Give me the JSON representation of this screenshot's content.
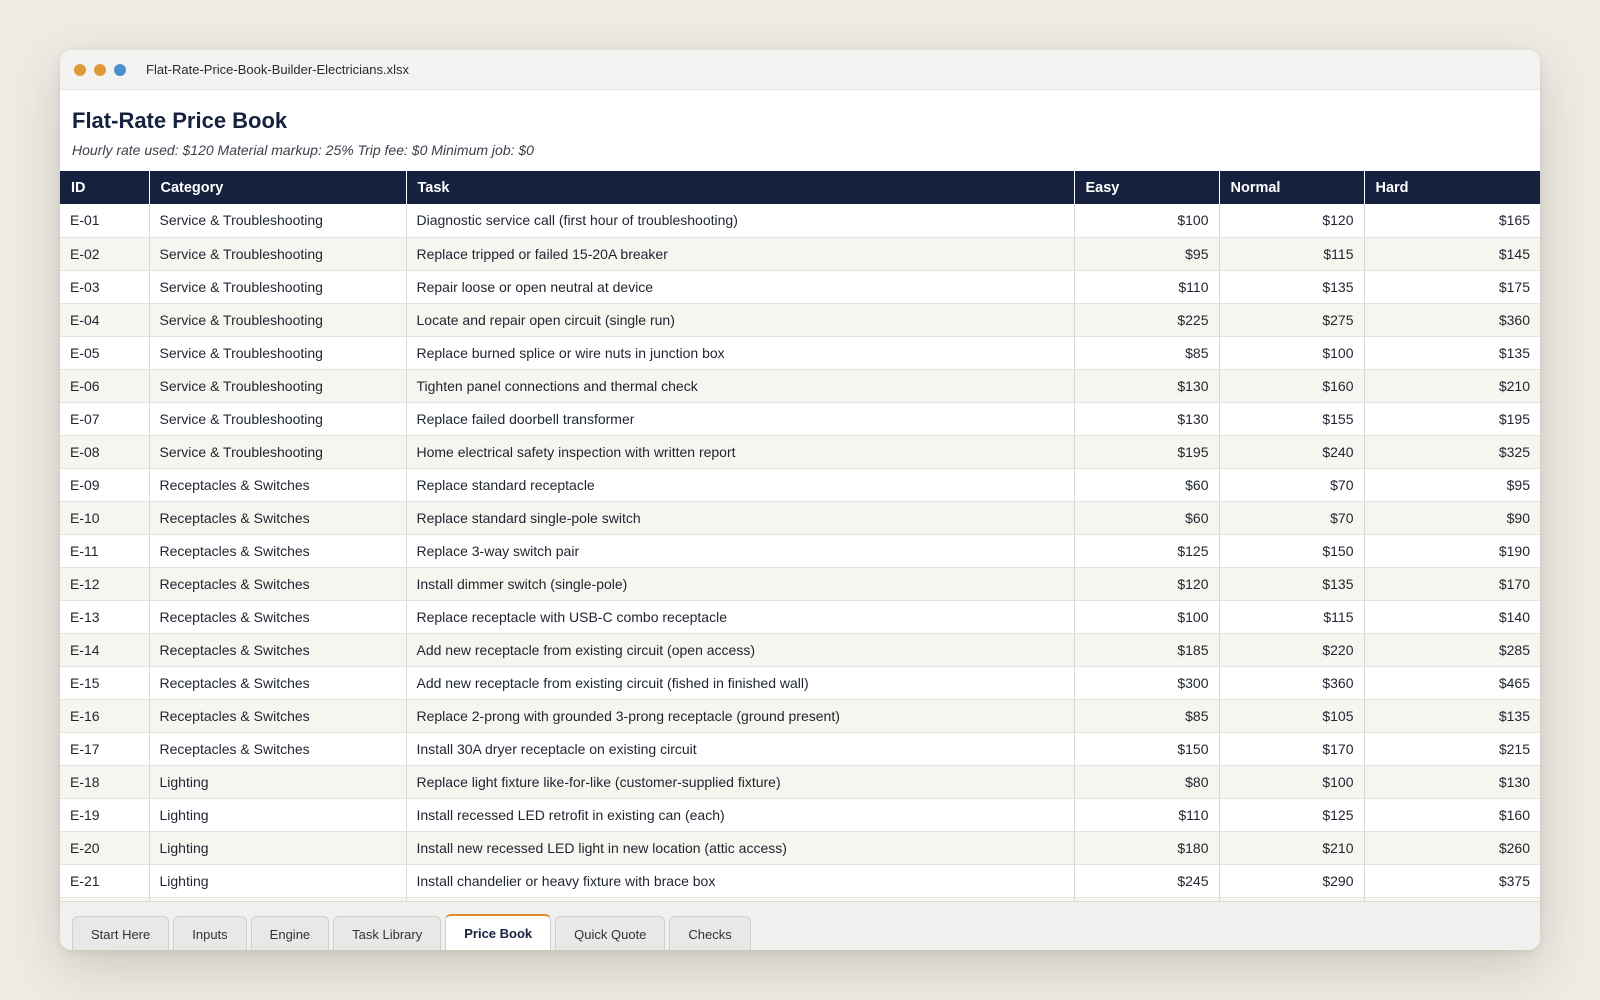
{
  "window": {
    "filename": "Flat-Rate-Price-Book-Builder-Electricians.xlsx"
  },
  "sheet": {
    "title": "Flat-Rate Price Book",
    "subtitle": "Hourly rate used: $120  Material markup: 25%  Trip fee: $0  Minimum job: $0"
  },
  "table": {
    "headers": [
      "ID",
      "Category",
      "Task",
      "Easy",
      "Normal",
      "Hard"
    ],
    "rows": [
      [
        "E-01",
        "Service & Troubleshooting",
        "Diagnostic service call (first hour of troubleshooting)",
        "$100",
        "$120",
        "$165"
      ],
      [
        "E-02",
        "Service & Troubleshooting",
        "Replace tripped or failed 15-20A breaker",
        "$95",
        "$115",
        "$145"
      ],
      [
        "E-03",
        "Service & Troubleshooting",
        "Repair loose or open neutral at device",
        "$110",
        "$135",
        "$175"
      ],
      [
        "E-04",
        "Service & Troubleshooting",
        "Locate and repair open circuit (single run)",
        "$225",
        "$275",
        "$360"
      ],
      [
        "E-05",
        "Service & Troubleshooting",
        "Replace burned splice or wire nuts in junction box",
        "$85",
        "$100",
        "$135"
      ],
      [
        "E-06",
        "Service & Troubleshooting",
        "Tighten panel connections and thermal check",
        "$130",
        "$160",
        "$210"
      ],
      [
        "E-07",
        "Service & Troubleshooting",
        "Replace failed doorbell transformer",
        "$130",
        "$155",
        "$195"
      ],
      [
        "E-08",
        "Service & Troubleshooting",
        "Home electrical safety inspection with written report",
        "$195",
        "$240",
        "$325"
      ],
      [
        "E-09",
        "Receptacles & Switches",
        "Replace standard receptacle",
        "$60",
        "$70",
        "$95"
      ],
      [
        "E-10",
        "Receptacles & Switches",
        "Replace standard single-pole switch",
        "$60",
        "$70",
        "$90"
      ],
      [
        "E-11",
        "Receptacles & Switches",
        "Replace 3-way switch pair",
        "$125",
        "$150",
        "$190"
      ],
      [
        "E-12",
        "Receptacles & Switches",
        "Install dimmer switch (single-pole)",
        "$120",
        "$135",
        "$170"
      ],
      [
        "E-13",
        "Receptacles & Switches",
        "Replace receptacle with USB-C combo receptacle",
        "$100",
        "$115",
        "$140"
      ],
      [
        "E-14",
        "Receptacles & Switches",
        "Add new receptacle from existing circuit (open access)",
        "$185",
        "$220",
        "$285"
      ],
      [
        "E-15",
        "Receptacles & Switches",
        "Add new receptacle from existing circuit (fished in finished wall)",
        "$300",
        "$360",
        "$465"
      ],
      [
        "E-16",
        "Receptacles & Switches",
        "Replace 2-prong with grounded 3-prong receptacle (ground present)",
        "$85",
        "$105",
        "$135"
      ],
      [
        "E-17",
        "Receptacles & Switches",
        "Install 30A dryer receptacle on existing circuit",
        "$150",
        "$170",
        "$215"
      ],
      [
        "E-18",
        "Lighting",
        "Replace light fixture like-for-like (customer-supplied fixture)",
        "$80",
        "$100",
        "$130"
      ],
      [
        "E-19",
        "Lighting",
        "Install recessed LED retrofit in existing can (each)",
        "$110",
        "$125",
        "$160"
      ],
      [
        "E-20",
        "Lighting",
        "Install new recessed LED light in new location (attic access)",
        "$180",
        "$210",
        "$260"
      ],
      [
        "E-21",
        "Lighting",
        "Install chandelier or heavy fixture with brace box",
        "$245",
        "$290",
        "$375"
      ],
      [
        "",
        "",
        "",
        "",
        "",
        ""
      ]
    ]
  },
  "tabs": [
    {
      "label": "Start Here",
      "active": false
    },
    {
      "label": "Inputs",
      "active": false
    },
    {
      "label": "Engine",
      "active": false
    },
    {
      "label": "Task Library",
      "active": false
    },
    {
      "label": "Price Book",
      "active": true
    },
    {
      "label": "Quick Quote",
      "active": false
    },
    {
      "label": "Checks",
      "active": false
    }
  ],
  "colors": {
    "header_bg": "#15213f",
    "active_tab_accent": "#e08a2c",
    "traffic_light_orange": "#e09a3c",
    "traffic_light_blue": "#4a8fd0"
  }
}
